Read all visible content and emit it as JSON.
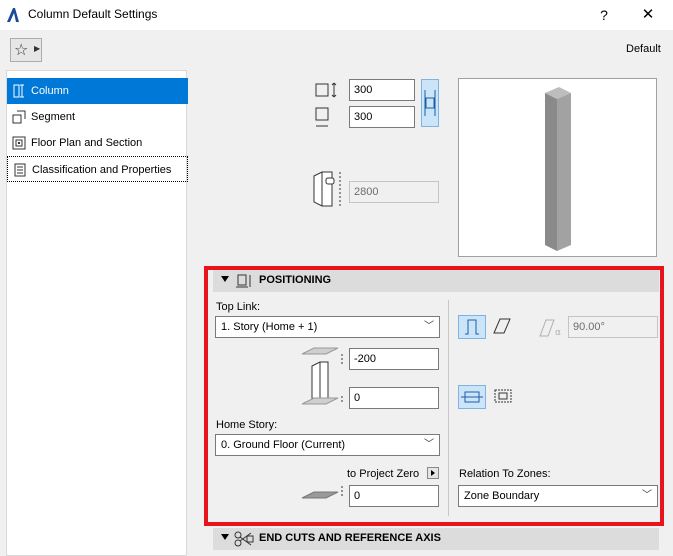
{
  "window": {
    "title": "Column Default Settings",
    "help": "?",
    "close": "✕"
  },
  "toolbar": {
    "preset": "Default"
  },
  "sidebar": {
    "items": [
      {
        "label": "Column"
      },
      {
        "label": "Segment"
      },
      {
        "label": "Floor Plan and Section"
      },
      {
        "label": "Classification and Properties"
      }
    ]
  },
  "geometry": {
    "width": "300",
    "depth": "300",
    "height": "2800"
  },
  "positioning": {
    "header": "POSITIONING",
    "top_link_label": "Top Link:",
    "top_link_value": "1. Story (Home + 1)",
    "top_offset": "-200",
    "bottom_offset": "0",
    "home_story_label": "Home Story:",
    "home_story_value": "0. Ground Floor (Current)",
    "to_project_zero_label": "to Project Zero",
    "project_zero_offset": "0",
    "slant_angle": "90.00°",
    "relation_label": "Relation To Zones:",
    "relation_value": "Zone Boundary"
  },
  "end_cuts": {
    "header": "END CUTS AND REFERENCE AXIS"
  }
}
